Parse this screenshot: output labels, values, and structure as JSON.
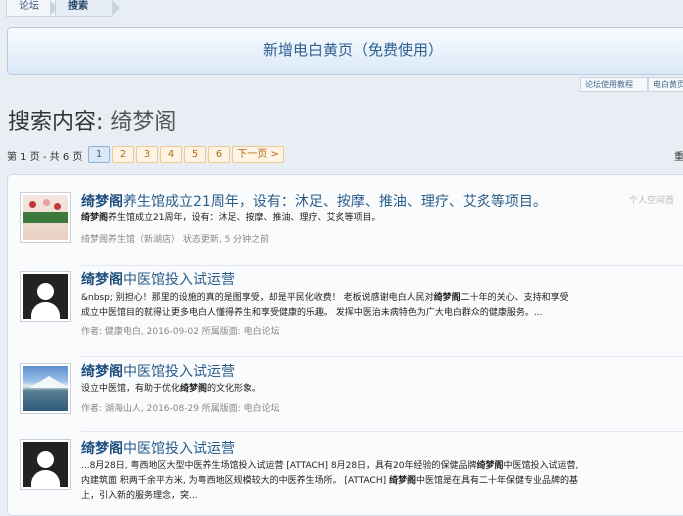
{
  "breadcrumb": {
    "items": [
      "论坛",
      "搜索"
    ]
  },
  "banner": {
    "label": "新增电白黄页（免费使用）"
  },
  "mini_tabs": [
    "论坛使用教程",
    "电白黄页"
  ],
  "search": {
    "label": "搜索内容:",
    "term": "绮梦阁"
  },
  "pager": {
    "info": "第 1 页 - 共 6 页",
    "pages": [
      "1",
      "2",
      "3",
      "4",
      "5",
      "6"
    ],
    "next": "下一页 >",
    "right_stub": "重"
  },
  "results": [
    {
      "title_hl": "绮梦阁",
      "title_rest": "养生馆成立21周年，设有：沐足、按摩、推油、理疗、艾炙等项目。",
      "snippet_hl": "绮梦阁",
      "snippet_rest": "养生馆成立21周年，设有：沐足、按摩、推油、理疗、艾炙等项目。",
      "meta": "绮梦阁养生馆（新湖店） 状态更新, 5 分钟之前",
      "side": "个人空间首",
      "thumb": "spa-photo"
    },
    {
      "title_hl": "绮梦阁",
      "title_rest": "中医馆投入试运营",
      "snippet_a": "&nbsp; 别担心！那里的设施的真的是图享受，却是平民化收费！ 老板说感谢电白人民对",
      "snippet_hl": "绮梦阁",
      "snippet_b": "二十年的关心、支持和享受",
      "snippet_line2": "成立中医馆目的就得让更多电白人懂得养生和享受健康的乐趣。 发挥中医治未病特色为广大电白群众的健康服务。...",
      "meta": "作者: 健康电白, 2016-09-02 所属版面: 电白论坛",
      "thumb": "avatar"
    },
    {
      "title_hl": "绮梦阁",
      "title_rest": "中医馆投入试运营",
      "snippet_a": "设立中医馆，有助于优化",
      "snippet_hl": "绮梦阁",
      "snippet_b": "的文化形象。",
      "meta": "作者: 湖海山人, 2016-08-29 所属版面: 电白论坛",
      "thumb": "lake-photo"
    },
    {
      "title_hl": "绮梦阁",
      "title_rest": "中医馆投入试运营",
      "snippet_a": "...8月28日, 粤西地区大型中医养生场馆投入试运营 [ATTACH] 8月28日，具有20年经验的保健品牌",
      "snippet_hl": "绮梦阁",
      "snippet_b": "中医馆投入试运营,",
      "snippet_line2_a": "内建筑面 积两千余平方米, 为粤西地区规模较大的中医养生场所。 [ATTACH] ",
      "snippet_line2_hl": "绮梦阁",
      "snippet_line2_b": "中医馆是在具有二十年保健专业品牌的基",
      "snippet_line3": "上，引入新的服务理念，突...",
      "thumb": "avatar"
    }
  ]
}
